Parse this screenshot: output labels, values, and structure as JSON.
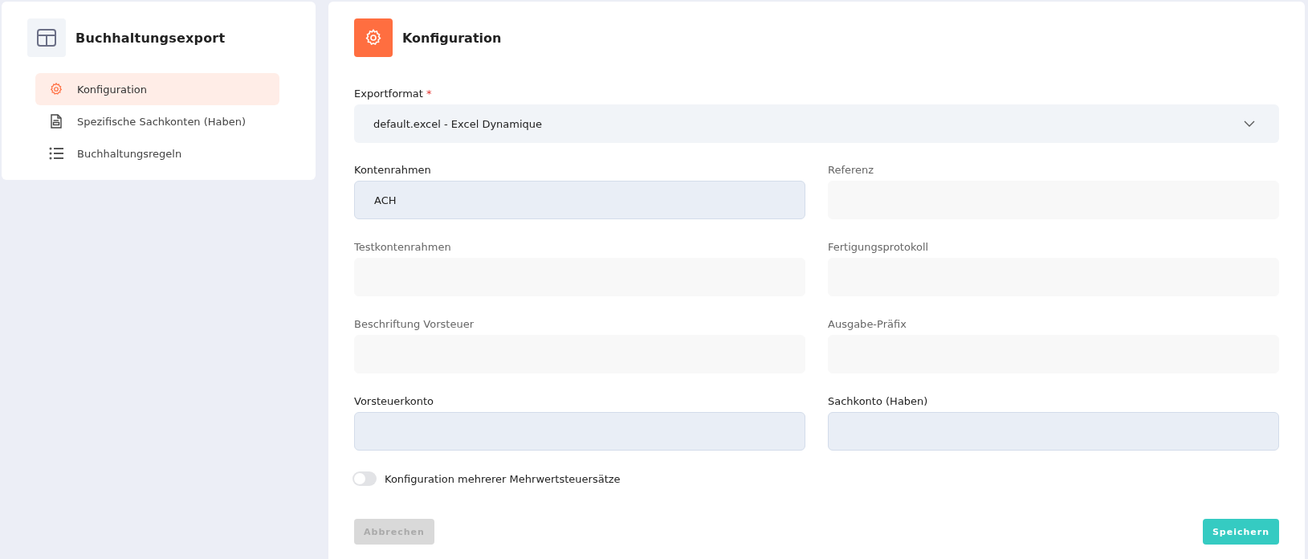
{
  "sidebar": {
    "title": "Buchhaltungsexport",
    "items": [
      {
        "label": "Konfiguration",
        "kind": "gear",
        "selected": true
      },
      {
        "label": "Spezifische Sachkonten (Haben)",
        "kind": "document",
        "selected": false
      },
      {
        "label": "Buchhaltungsregeln",
        "kind": "list",
        "selected": false
      }
    ]
  },
  "panel": {
    "title": "Konfiguration"
  },
  "export_format": {
    "label": "Exportformat",
    "required_mark": "*",
    "value": "default.excel - Excel Dynamique"
  },
  "fields": [
    {
      "label": "Kontenrahmen",
      "value": "ACH",
      "disabled": false
    },
    {
      "label": "Referenz",
      "disabled": true
    },
    {
      "label": "Testkontenrahmen",
      "disabled": true
    },
    {
      "label": "Fertigungsprotokoll",
      "disabled": true
    },
    {
      "label": "Beschriftung Vorsteuer",
      "disabled": true
    },
    {
      "label": "Ausgabe-Präfix",
      "disabled": true
    },
    {
      "label": "Vorsteuerkonto",
      "disabled": false
    },
    {
      "label": "Sachkonto (Haben)",
      "disabled": false
    }
  ],
  "toggle": {
    "label": "Konfiguration mehrerer Mehrwertsteuersätze",
    "on": false
  },
  "buttons": [
    {
      "label": "Abbrechen",
      "kind": "cancel",
      "disabled": true
    },
    {
      "label": "Speichern",
      "kind": "save",
      "disabled": false
    }
  ]
}
